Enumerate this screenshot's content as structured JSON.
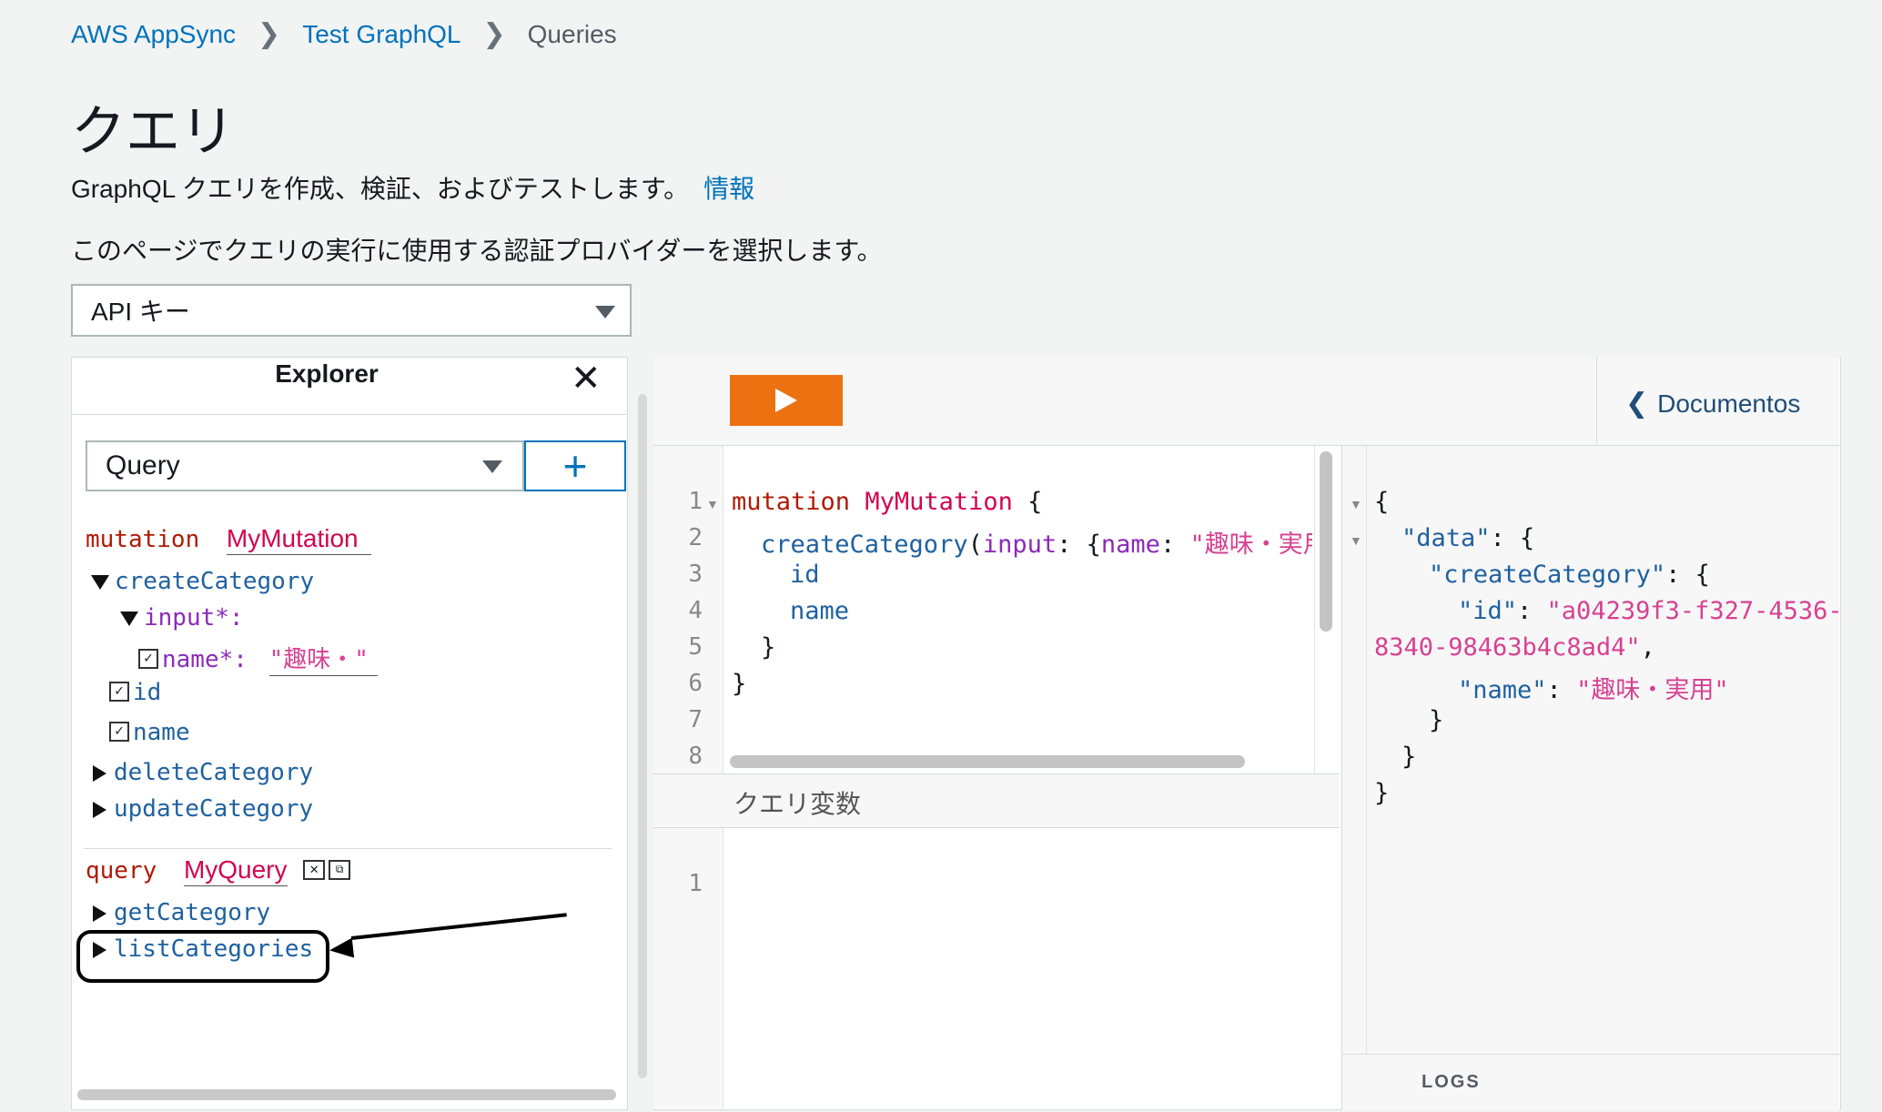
{
  "breadcrumb": [
    "AWS AppSync",
    "Test GraphQL",
    "Queries"
  ],
  "page": {
    "title": "クエリ",
    "description": "GraphQL クエリを作成、検証、およびテストします。",
    "info_link": "情報",
    "auth_prompt": "このページでクエリの実行に使用する認証プロバイダーを選択します。",
    "auth_selected": "API キー"
  },
  "explorer": {
    "title": "Explorer",
    "operation_type": "Query",
    "mutation_keyword": "mutation",
    "mutation_name": "MyMutation",
    "mutation_fields": [
      "createCategory",
      "deleteCategory",
      "updateCategory"
    ],
    "input_label": "input*:",
    "name_arg": "name*:",
    "name_value": "\"趣味・\"",
    "selected_fields": [
      "id",
      "name"
    ],
    "query_keyword": "query",
    "query_name": "MyQuery",
    "query_fields": [
      "getCategory",
      "listCategories"
    ]
  },
  "editor": {
    "line_numbers": [
      "1",
      "2",
      "3",
      "4",
      "5",
      "6",
      "7",
      "8"
    ],
    "l1_kw": "mutation",
    "l1_name": "MyMutation",
    "l1_brace": "{",
    "l2_field": "createCategory",
    "l2_paren": "(",
    "l2_arg": "input",
    "l2_colon": ": {",
    "l2_key": "name",
    "l2_colon2": ": ",
    "l2_str": "\"趣味・実用'",
    "l3": "id",
    "l4": "name",
    "l5": "}",
    "l6": "}",
    "variables_label": "クエリ変数",
    "variables_line": "1"
  },
  "docs_label": "Documentos",
  "result": {
    "open_brace": "{",
    "data_key": "\"data\"",
    "create_key": "\"createCategory\"",
    "id_key": "\"id\"",
    "id_val_1": "\"a04239f3-f327-4536-",
    "id_val_2": "8340-98463b4c8ad4\"",
    "name_key": "\"name\"",
    "name_val": "\"趣味・実用\"",
    "close_brace": "}"
  },
  "logs_label": "LOGS",
  "colors": {
    "run_button": "#ec7211",
    "link": "#0073bb"
  }
}
